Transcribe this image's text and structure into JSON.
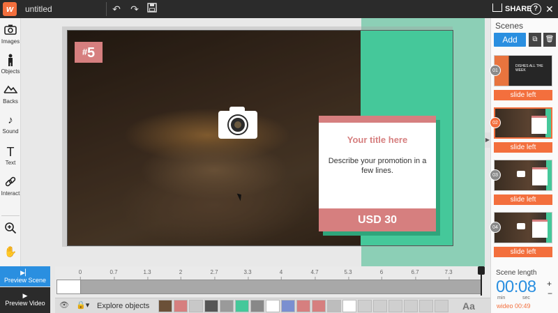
{
  "app": {
    "logo": "w",
    "title": "untitled"
  },
  "toolbar": {
    "undo_icon": "undo-icon",
    "redo_icon": "redo-icon",
    "save_icon": "save-icon",
    "share_label": "SHARE",
    "help_label": "?",
    "close_label": "✕"
  },
  "tools": [
    {
      "icon": "camera-icon",
      "label": "Images"
    },
    {
      "icon": "person-icon",
      "label": "Objects"
    },
    {
      "icon": "mountain-icon",
      "label": "Backs"
    },
    {
      "icon": "music-note-icon",
      "label": "Sound"
    },
    {
      "icon": "text-icon",
      "label": "Text"
    },
    {
      "icon": "link-icon",
      "label": "Interact"
    }
  ],
  "zoom_icon": "zoom-in-icon",
  "hand_icon": "hand-icon",
  "canvas": {
    "badge_hash": "#",
    "badge_number": "5",
    "card_title": "Your title here",
    "card_desc": "Describe your promotion in a few lines.",
    "card_price": "USD 30",
    "colors": {
      "badge": "#d67f7f",
      "teal": "#45c89a",
      "accent": "#f36f3d"
    }
  },
  "scenes_panel": {
    "title": "Scenes",
    "add_label": "Add",
    "scenes": [
      {
        "num": "01",
        "label": "slide left",
        "mini_text": "DISHES ALL THE WEEK"
      },
      {
        "num": "02",
        "label": "slide left"
      },
      {
        "num": "03",
        "label": "slide left"
      },
      {
        "num": "04",
        "label": "slide left"
      }
    ]
  },
  "timeline": {
    "ticks": [
      "0",
      "0.7",
      "1.3",
      "2",
      "2.7",
      "3.3",
      "4",
      "4.7",
      "5.3",
      "6",
      "6.7",
      "7.3"
    ]
  },
  "preview": {
    "scene_label": "Preview Scene",
    "video_label": "Preview Video"
  },
  "bottom": {
    "explore_label": "Explore objects",
    "aa_label": "Aa",
    "swatches": [
      "#6b5038",
      "#d67f7f",
      "#c8c8c8",
      "#555555",
      "#9a9a9a",
      "#45c89a",
      "#888888",
      "#ffffff",
      "#7a8fd0",
      "#d67f7f",
      "#d67f7f",
      "#bdbdbd",
      "#ffffff",
      "#cfcfcf",
      "#cfcfcf",
      "#cfcfcf",
      "#cfcfcf",
      "#cfcfcf",
      "#cfcfcf"
    ]
  },
  "scene_length": {
    "title": "Scene length",
    "time": "00:08",
    "min_label": "min",
    "sec_label": "sec",
    "video_length": "wideo 00:49"
  }
}
